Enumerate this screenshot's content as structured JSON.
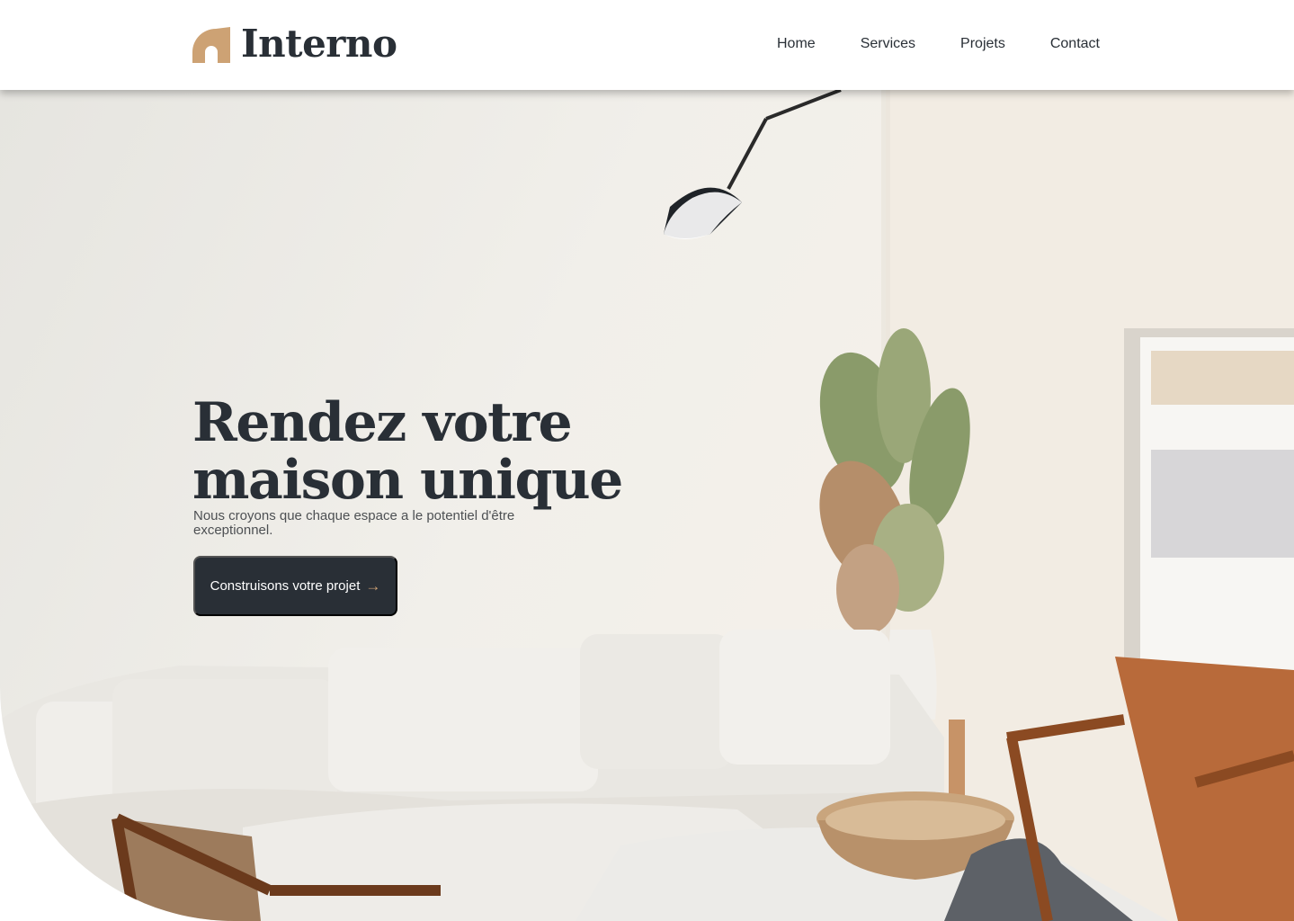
{
  "header": {
    "brand": "Interno",
    "nav": [
      {
        "label": "Home"
      },
      {
        "label": "Services"
      },
      {
        "label": "Projets"
      },
      {
        "label": "Contact"
      }
    ]
  },
  "hero": {
    "title": "Rendez votre maison unique",
    "subtitle": "Nous croyons que chaque espace a le potentiel d'être exceptionnel.",
    "cta_label": "Construisons votre projet",
    "cta_icon": "arrow-right-icon"
  },
  "colors": {
    "primary": "#292f36",
    "accent": "#cda274",
    "background": "#ffffff"
  }
}
